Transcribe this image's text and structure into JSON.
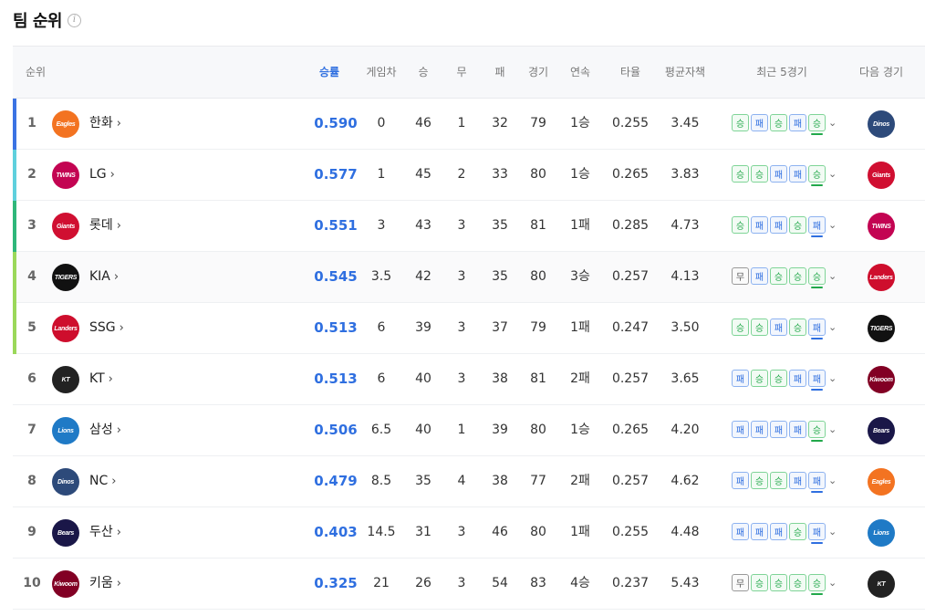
{
  "page": {
    "title": "팀 순위",
    "info_icon": "info-icon"
  },
  "columns": {
    "rank": "순위",
    "pct": "승률",
    "gb": "게임차",
    "wins": "승",
    "draws": "무",
    "losses": "패",
    "games": "경기",
    "streak": "연속",
    "avg": "타율",
    "era": "평균자책",
    "recent": "최근 5경기",
    "next": "다음 경기"
  },
  "results": {
    "W": "승",
    "L": "패",
    "D": "무"
  },
  "teams": {
    "eagles": {
      "mark": "Eagles",
      "color": "#f37321"
    },
    "twins": {
      "mark": "TWINS",
      "color": "#c30452"
    },
    "giants": {
      "mark": "Giants",
      "color": "#d00f31"
    },
    "tigers": {
      "mark": "TIGERS",
      "color": "#111111"
    },
    "landers": {
      "mark": "Landers",
      "color": "#ce0e2d"
    },
    "ktwiz": {
      "mark": "KT",
      "color": "#222222"
    },
    "lions": {
      "mark": "Lions",
      "color": "#1f7ac6"
    },
    "dinos": {
      "mark": "Dinos",
      "color": "#2d4a7a"
    },
    "bears": {
      "mark": "Bears",
      "color": "#1a1748"
    },
    "heroes": {
      "mark": "Kiwoom",
      "color": "#820024"
    }
  },
  "rows": [
    {
      "rank": "1",
      "team": "eagles",
      "name": "한화",
      "pct": "0.590",
      "gb": "0",
      "w": "46",
      "d": "1",
      "l": "32",
      "g": "79",
      "streak": "1승",
      "avg": "0.255",
      "era": "3.45",
      "recent": [
        "W",
        "L",
        "W",
        "L",
        "W"
      ],
      "next": "dinos",
      "bar": "#3b73e3"
    },
    {
      "rank": "2",
      "team": "twins",
      "name": "LG",
      "pct": "0.577",
      "gb": "1",
      "w": "45",
      "d": "2",
      "l": "33",
      "g": "80",
      "streak": "1승",
      "avg": "0.265",
      "era": "3.83",
      "recent": [
        "W",
        "W",
        "L",
        "L",
        "W"
      ],
      "next": "giants",
      "bar": "#5fd0dd"
    },
    {
      "rank": "3",
      "team": "giants",
      "name": "롯데",
      "pct": "0.551",
      "gb": "3",
      "w": "43",
      "d": "3",
      "l": "35",
      "g": "81",
      "streak": "1패",
      "avg": "0.285",
      "era": "4.73",
      "recent": [
        "W",
        "L",
        "L",
        "W",
        "L"
      ],
      "next": "twins",
      "bar": "#2fb77a"
    },
    {
      "rank": "4",
      "team": "tigers",
      "name": "KIA",
      "pct": "0.545",
      "gb": "3.5",
      "w": "42",
      "d": "3",
      "l": "35",
      "g": "80",
      "streak": "3승",
      "avg": "0.257",
      "era": "4.13",
      "recent": [
        "D",
        "L",
        "W",
        "W",
        "W"
      ],
      "next": "landers",
      "bar": "#9bd85a"
    },
    {
      "rank": "5",
      "team": "landers",
      "name": "SSG",
      "pct": "0.513",
      "gb": "6",
      "w": "39",
      "d": "3",
      "l": "37",
      "g": "79",
      "streak": "1패",
      "avg": "0.247",
      "era": "3.50",
      "recent": [
        "W",
        "W",
        "L",
        "W",
        "L"
      ],
      "next": "tigers",
      "bar": "#9bd85a"
    },
    {
      "rank": "6",
      "team": "ktwiz",
      "name": "KT",
      "pct": "0.513",
      "gb": "6",
      "w": "40",
      "d": "3",
      "l": "38",
      "g": "81",
      "streak": "2패",
      "avg": "0.257",
      "era": "3.65",
      "recent": [
        "L",
        "W",
        "W",
        "L",
        "L"
      ],
      "next": "heroes",
      "bar": ""
    },
    {
      "rank": "7",
      "team": "lions",
      "name": "삼성",
      "pct": "0.506",
      "gb": "6.5",
      "w": "40",
      "d": "1",
      "l": "39",
      "g": "80",
      "streak": "1승",
      "avg": "0.265",
      "era": "4.20",
      "recent": [
        "L",
        "L",
        "L",
        "L",
        "W"
      ],
      "next": "bears",
      "bar": ""
    },
    {
      "rank": "8",
      "team": "dinos",
      "name": "NC",
      "pct": "0.479",
      "gb": "8.5",
      "w": "35",
      "d": "4",
      "l": "38",
      "g": "77",
      "streak": "2패",
      "avg": "0.257",
      "era": "4.62",
      "recent": [
        "L",
        "W",
        "W",
        "L",
        "L"
      ],
      "next": "eagles",
      "bar": ""
    },
    {
      "rank": "9",
      "team": "bears",
      "name": "두산",
      "pct": "0.403",
      "gb": "14.5",
      "w": "31",
      "d": "3",
      "l": "46",
      "g": "80",
      "streak": "1패",
      "avg": "0.255",
      "era": "4.48",
      "recent": [
        "L",
        "L",
        "L",
        "W",
        "L"
      ],
      "next": "lions",
      "bar": ""
    },
    {
      "rank": "10",
      "team": "heroes",
      "name": "키움",
      "pct": "0.325",
      "gb": "21",
      "w": "26",
      "d": "3",
      "l": "54",
      "g": "83",
      "streak": "4승",
      "avg": "0.237",
      "era": "5.43",
      "recent": [
        "D",
        "W",
        "W",
        "W",
        "W"
      ],
      "next": "ktwiz",
      "bar": ""
    }
  ]
}
